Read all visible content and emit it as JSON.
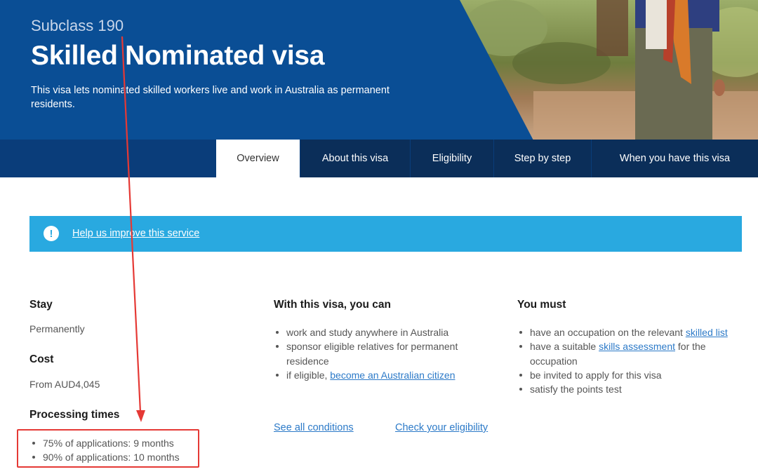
{
  "hero": {
    "subclass": "Subclass 190",
    "title": "Skilled Nominated visa",
    "description": "This visa lets nominated skilled workers live and work in Australia as permanent residents."
  },
  "tabs": [
    {
      "label": "Overview",
      "active": true
    },
    {
      "label": "About this visa",
      "active": false
    },
    {
      "label": "Eligibility",
      "active": false
    },
    {
      "label": "Step by step",
      "active": false
    },
    {
      "label": "When you have this visa",
      "active": false
    }
  ],
  "alert": {
    "icon": "exclamation-icon",
    "link_text": "Help us improve this service"
  },
  "summary": {
    "stay_heading": "Stay",
    "stay_value": "Permanently",
    "cost_heading": "Cost",
    "cost_value": "From AUD4,045",
    "processing_heading": "Processing times",
    "processing_items": [
      "75% of applications: 9 months",
      "90% of applications: 10 months"
    ]
  },
  "with_visa": {
    "heading": "With this visa, you can",
    "item1": "work and study anywhere in Australia",
    "item2": "sponsor eligible relatives for permanent residence",
    "item3_prefix": "if eligible, ",
    "item3_link": "become an Australian citizen"
  },
  "you_must": {
    "heading": "You must",
    "item1_prefix": "have an occupation on the relevant ",
    "item1_link": "skilled list",
    "item2_prefix": "have a suitable ",
    "item2_link": "skills assessment",
    "item2_suffix": " for the occupation",
    "item3": "be invited to apply for this visa",
    "item4": "satisfy the points test"
  },
  "links": {
    "see_all": "See all conditions",
    "check": "Check your eligibility"
  },
  "colors": {
    "navy": "#0a3d7a",
    "tab_dark": "#0b2e59",
    "alert_blue": "#29a9e0",
    "link_blue": "#2c7ac8",
    "annotation_red": "#e53935"
  }
}
